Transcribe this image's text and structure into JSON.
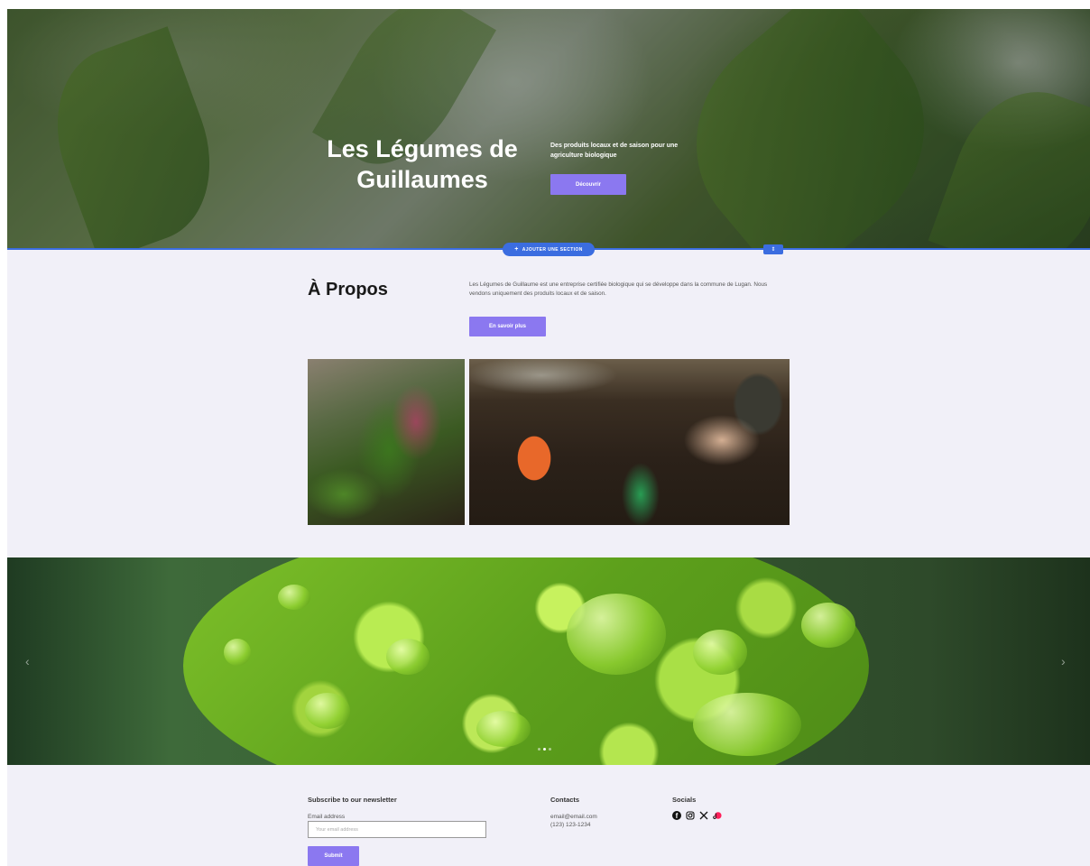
{
  "hero": {
    "title_line1": "Les Légumes de",
    "title_line2": "Guillaumes",
    "subtitle": "Des produits locaux et de saison pour une agriculture biologique",
    "button_label": "Découvrir"
  },
  "editor": {
    "add_section_label": "AJOUTER UNE SECTION",
    "add_section_icon": "plus-icon",
    "section_options_icon": "sort-icon",
    "accent_color": "#3b6de0"
  },
  "about": {
    "title": "À Propos",
    "text": "Les Légumes de Guillaume est une entreprise certifiée biologique qui se développe dans la commune de Lugan. Nous vendons uniquement des produits locaux et de saison.",
    "button_label": "En savoir plus"
  },
  "banner": {
    "prev_icon": "chevron-left-icon",
    "next_icon": "chevron-right-icon",
    "slide_count": 3,
    "active_slide": 2
  },
  "footer": {
    "newsletter_heading": "Subscribe to our newsletter",
    "email_label": "Email address",
    "email_placeholder": "Your email address",
    "submit_label": "Submit",
    "contacts_heading": "Contacts",
    "contact_email": "email@email.com",
    "contact_phone": "(123) 123-1234",
    "socials_heading": "Socials",
    "social_icons": [
      "facebook-icon",
      "instagram-icon",
      "x-icon",
      "tiktok-icon"
    ]
  },
  "colors": {
    "button_purple": "#8b78f0",
    "background": "#f1f0f8"
  }
}
